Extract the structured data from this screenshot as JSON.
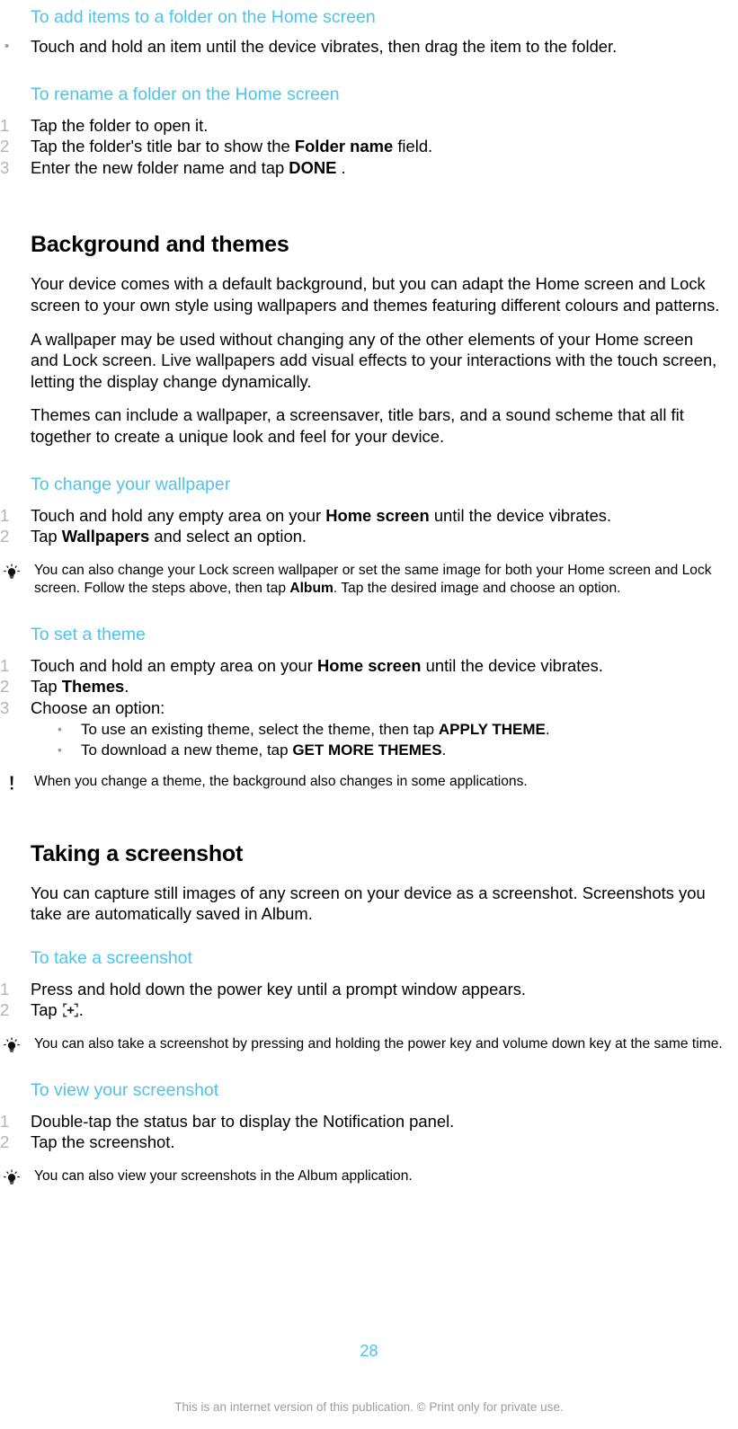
{
  "document": {
    "page_number": "28",
    "footer_note": "This is an internet version of this publication. © Print only for private use.",
    "accent_color": "#4ec3e8",
    "marker_color": "#b3b3b3",
    "footer_color": "#9d9d9d"
  },
  "sections": {
    "add_items": {
      "heading": "To add items to a folder on the Home screen",
      "bullet_marker": "•",
      "step_1": "Touch and hold an item until the device vibrates, then drag the item to the folder."
    },
    "rename_folder": {
      "heading": "To rename a folder on the Home screen",
      "m1": "1",
      "m2": "2",
      "m3": "3",
      "step_1": "Tap the folder to open it.",
      "step_2_a": "Tap the folder's title bar to show the ",
      "step_2_b": "Folder name",
      "step_2_c": " field.",
      "step_3_a": "Enter the new folder name and tap ",
      "step_3_b": "DONE",
      "step_3_c": " ."
    },
    "background_themes": {
      "title": "Background and themes",
      "para_1": "Your device comes with a default background, but you can adapt the Home screen and Lock screen to your own style using wallpapers and themes featuring different colours and patterns.",
      "para_2": "A wallpaper may be used without changing any of the other elements of your Home screen and Lock screen. Live wallpapers add visual effects to your interactions with the touch screen, letting the display change dynamically.",
      "para_3": "Themes can include a wallpaper, a screensaver, title bars, and a sound scheme that all fit together to create a unique look and feel for your device."
    },
    "change_wallpaper": {
      "heading": "To change your wallpaper",
      "m1": "1",
      "m2": "2",
      "step_1_a": "Touch and hold any empty area on your ",
      "step_1_b": "Home screen",
      "step_1_c": " until the device vibrates.",
      "step_2_a": "Tap ",
      "step_2_b": "Wallpapers",
      "step_2_c": " and select an option.",
      "tip_icon": "lightbulb-icon",
      "tip_a": "You can also change your Lock screen wallpaper or set the same image for both your Home screen and Lock screen. Follow the steps above, then tap ",
      "tip_b": "Album",
      "tip_c": ". Tap the desired image and choose an option."
    },
    "set_theme": {
      "heading": "To set a theme",
      "m1": "1",
      "m2": "2",
      "m3": "3",
      "sub_bullet": "•",
      "step_1_a": "Touch and hold an empty area on your ",
      "step_1_b": "Home screen",
      "step_1_c": " until the device vibrates.",
      "step_2_a": "Tap ",
      "step_2_b": "Themes",
      "step_2_c": ".",
      "step_3": "Choose an option:",
      "sub_1_a": "To use an existing theme, select the theme, then tap ",
      "sub_1_b": "APPLY THEME",
      "sub_1_c": ".",
      "sub_2_a": "To download a new theme, tap ",
      "sub_2_b": "GET MORE THEMES",
      "sub_2_c": ".",
      "note_icon": "exclamation-icon",
      "note": "When you change a theme, the background also changes in some applications."
    },
    "taking_screenshot": {
      "title": "Taking a screenshot",
      "para_1": "You can capture still images of any screen on your device as a screenshot. Screenshots you take are automatically saved in Album."
    },
    "take_screenshot": {
      "heading": "To take a screenshot",
      "m1": "1",
      "m2": "2",
      "step_1": "Press and hold down the power key until a prompt window appears.",
      "step_2_a": "Tap ",
      "step_2_icon": "screenshot-capture-icon",
      "step_2_c": ".",
      "tip_icon": "lightbulb-icon",
      "tip": "You can also take a screenshot by pressing and holding the power key and volume down key at the same time."
    },
    "view_screenshot": {
      "heading": "To view your screenshot",
      "m1": "1",
      "m2": "2",
      "step_1": "Double-tap the status bar to display the Notification panel.",
      "step_2": "Tap the screenshot.",
      "tip_icon": "lightbulb-icon",
      "tip": "You can also view your screenshots in the Album application."
    }
  }
}
